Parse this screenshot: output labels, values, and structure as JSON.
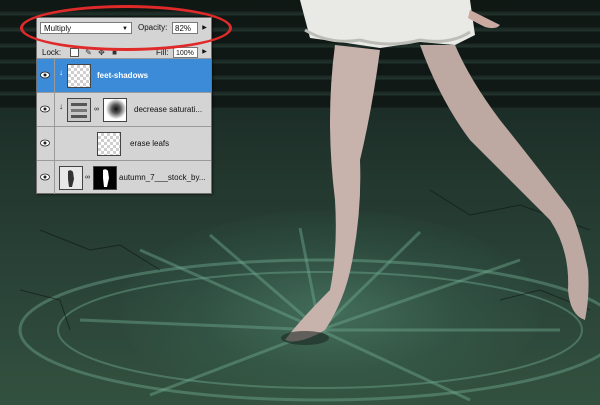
{
  "layers_panel": {
    "blend_mode": "Multiply",
    "opacity_label": "Opacity:",
    "opacity_value": "82%",
    "lock_label": "Lock:",
    "fill_label": "Fill:",
    "fill_value": "100%",
    "layers": [
      {
        "name": "feet-shadows",
        "selected": true
      },
      {
        "name": "decrease saturati...",
        "selected": false
      },
      {
        "name": "erase leafs",
        "selected": false
      },
      {
        "name": "autumn_7___stock_by...",
        "selected": false
      }
    ]
  },
  "colors": {
    "highlight": "#e02a2a",
    "selection": "#3c8bd8",
    "panel_bg": "#d4d4d4",
    "floor_tint": "#33513f"
  },
  "icons": [
    "eye-icon",
    "chevron-down-icon",
    "link-icon",
    "brush-icon",
    "move-icon",
    "lock-icon",
    "clip-arrow-icon",
    "flyout-arrow-icon"
  ]
}
